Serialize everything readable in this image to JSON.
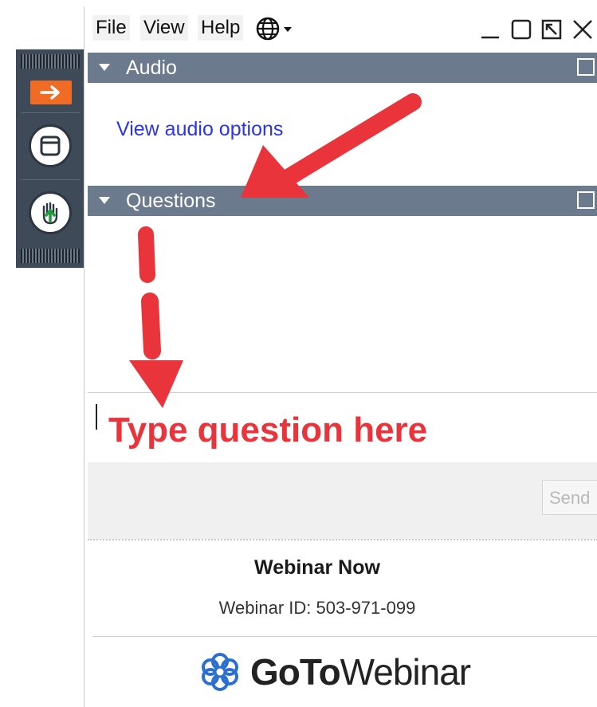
{
  "menubar": {
    "items": [
      "File",
      "View",
      "Help"
    ],
    "language_icon": "globe-dropdown-icon"
  },
  "window_controls": [
    "minimize-icon",
    "maximize-icon",
    "popout-icon",
    "close-icon"
  ],
  "sections": {
    "audio": {
      "title": "Audio",
      "link": "View audio options"
    },
    "questions": {
      "title": "Questions"
    }
  },
  "question_input": {
    "annotation": "Type question here"
  },
  "send_label": "Send",
  "footer": {
    "webinar_title": "Webinar Now",
    "webinar_id": "Webinar ID: 503-971-099",
    "brand_bold": "GoTo",
    "brand_rest": "Webinar"
  },
  "colors": {
    "header_bar": "#6b7a8c",
    "annotation_red": "#e8343a",
    "link_blue": "#2b34e8",
    "orange_button": "#f06b23",
    "grab_panel": "#3e4a57"
  }
}
